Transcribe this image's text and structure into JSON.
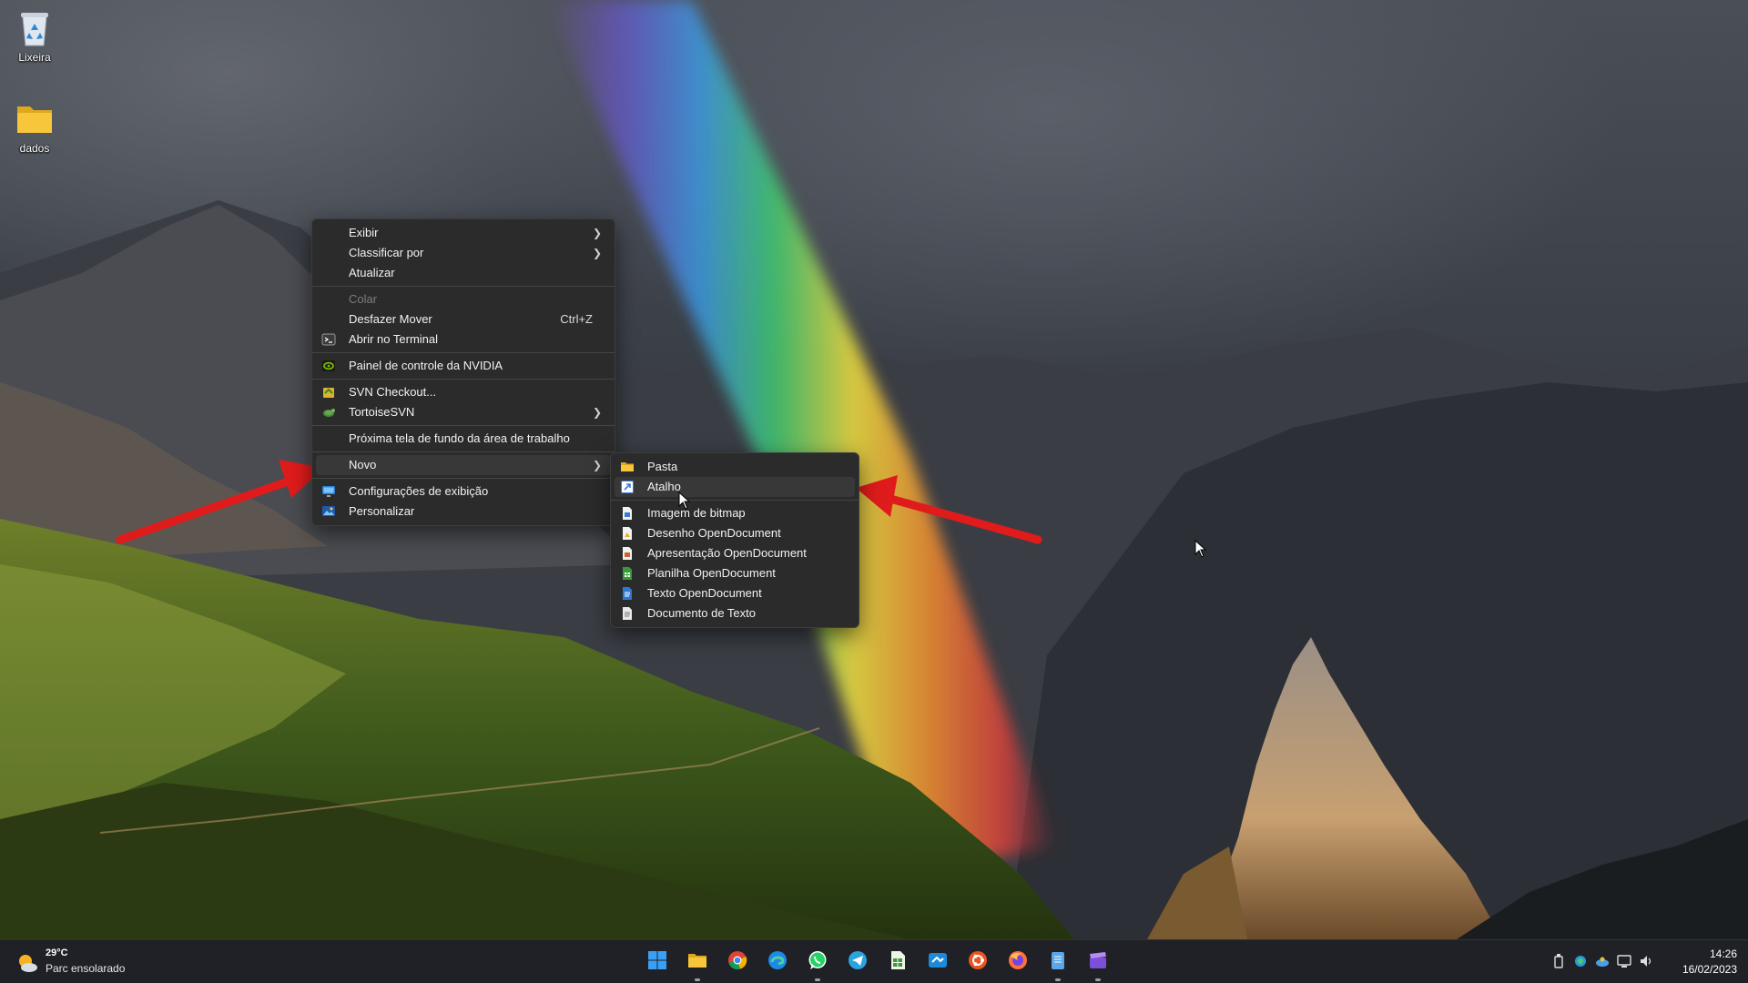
{
  "desktop": {
    "icons": [
      {
        "label": "Lixeira",
        "icon": "recycle-bin-icon"
      },
      {
        "label": "dados",
        "icon": "folder-icon"
      }
    ]
  },
  "context_menu": {
    "items": {
      "exibir": "Exibir",
      "classificar": "Classificar por",
      "atualizar": "Atualizar",
      "colar": "Colar",
      "desfazer": "Desfazer Mover",
      "desfazer_shortcut": "Ctrl+Z",
      "terminal": "Abrir no Terminal",
      "nvidia": "Painel de controle da NVIDIA",
      "svn_checkout": "SVN Checkout...",
      "tortoise": "TortoiseSVN",
      "proxima": "Próxima tela de fundo da área de trabalho",
      "novo": "Novo",
      "config_exibicao": "Configurações de exibição",
      "personalizar": "Personalizar"
    }
  },
  "new_submenu": {
    "items": {
      "pasta": "Pasta",
      "atalho": "Atalho",
      "bitmap": "Imagem de bitmap",
      "desenho": "Desenho OpenDocument",
      "apresentacao": "Apresentação OpenDocument",
      "planilha": "Planilha OpenDocument",
      "texto_od": "Texto OpenDocument",
      "doc_texto": "Documento de Texto"
    }
  },
  "taskbar": {
    "weather": {
      "temp": "29°C",
      "desc": "Parc ensolarado"
    },
    "apps": [
      "windows-start-icon",
      "file-explorer-icon",
      "chrome-icon",
      "edge-icon",
      "whatsapp-icon",
      "telegram-icon",
      "sheets-icon",
      "app-icon",
      "ubuntu-icon",
      "firefox-icon",
      "notepad-icon",
      "clapper-icon"
    ],
    "clock": {
      "time": "14:26",
      "date": "16/02/2023"
    }
  },
  "colors": {
    "menu_bg": "#2b2b2b",
    "annotation_arrow": "#e01b1b",
    "taskbar_bg": "#1f2126"
  }
}
